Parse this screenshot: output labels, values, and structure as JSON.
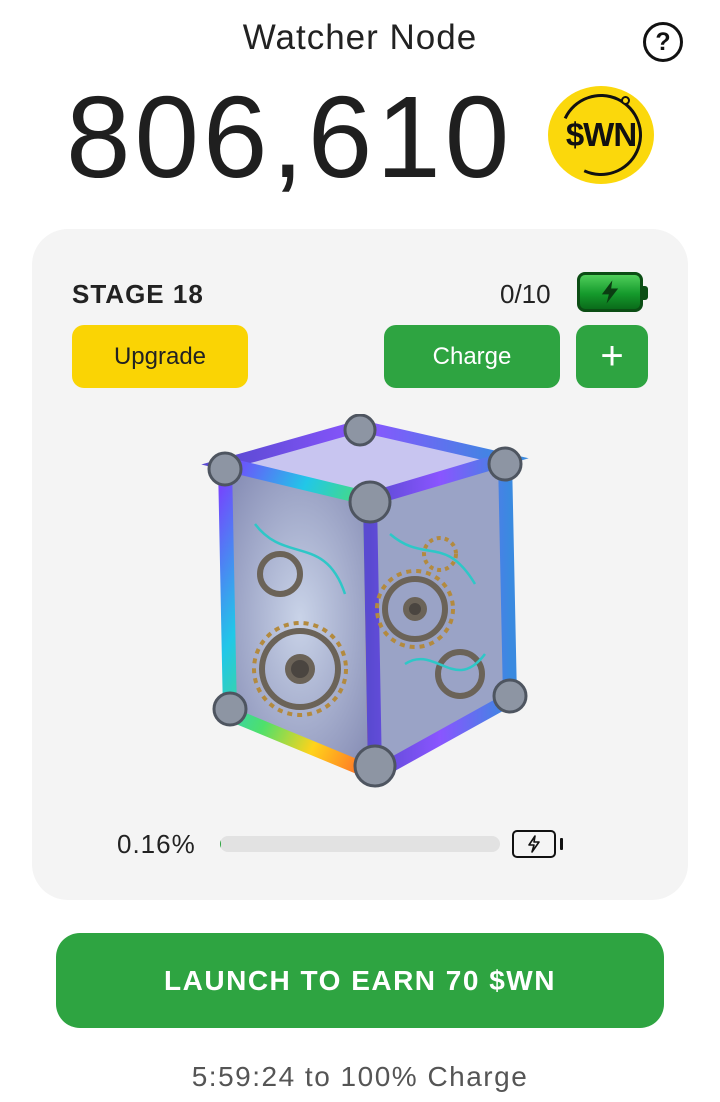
{
  "header": {
    "title": "Watcher Node",
    "help_icon": "help-circle-icon",
    "help_glyph": "?"
  },
  "balance": {
    "amount": "806,610",
    "token_symbol": "$WN",
    "token_color": "#fbd80c"
  },
  "node": {
    "stage_label": "STAGE 18",
    "charges": "0/10",
    "battery_icon": "battery-charging-icon",
    "buttons": {
      "upgrade": "Upgrade",
      "charge": "Charge",
      "plus": "+"
    },
    "progress": {
      "label": "0.16%",
      "value": 0.0016
    },
    "image_name": "mechanical-gear-cube"
  },
  "launch": {
    "label": "LAUNCH TO EARN 70 $WN"
  },
  "status": {
    "timer_text": "5:59:24 to 100% Charge"
  },
  "colors": {
    "green": "#2ea441",
    "yellow": "#fad404",
    "card_bg": "#f4f4f4"
  }
}
